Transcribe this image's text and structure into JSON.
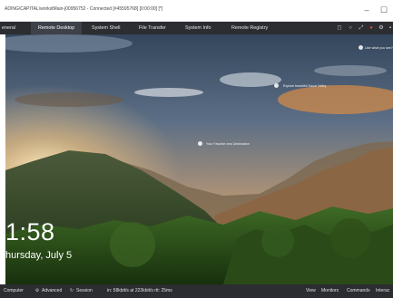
{
  "window": {
    "title": "ADING\\CAPITAL\\workstMain-j00956752 - Connected [#45595768] [0:00:00] [*]",
    "minimize_glyph": "–",
    "maximize_glyph": "☐"
  },
  "tabs": [
    "eneral",
    "Remote Desktop",
    "System Shell",
    "File Transfer",
    "System Info",
    "Remote Registry"
  ],
  "active_tab": "Remote Desktop",
  "toolbar_icons": [
    "chat-icon",
    "pin-icon",
    "fullscreen-icon",
    "record-icon",
    "settings-icon",
    "more-icon"
  ],
  "remote_screen": {
    "hints": [
      "Like what you see?",
      "Explore beautiful Kauai Valley",
      "Your Favorite new Destination"
    ],
    "time": "1:58",
    "date": "hursday, July 5"
  },
  "status_bar": {
    "left": [
      "Computer",
      "Advanced",
      "Session"
    ],
    "connection": "in: 58kbit/s at 223kbit/s rtt: 25ms",
    "right": [
      "View",
      "Monitors",
      "Commands",
      "Interac"
    ]
  },
  "colors": {
    "navbar": "#2b2d31",
    "active_tab": "#3e4149",
    "record": "#e0434a"
  }
}
